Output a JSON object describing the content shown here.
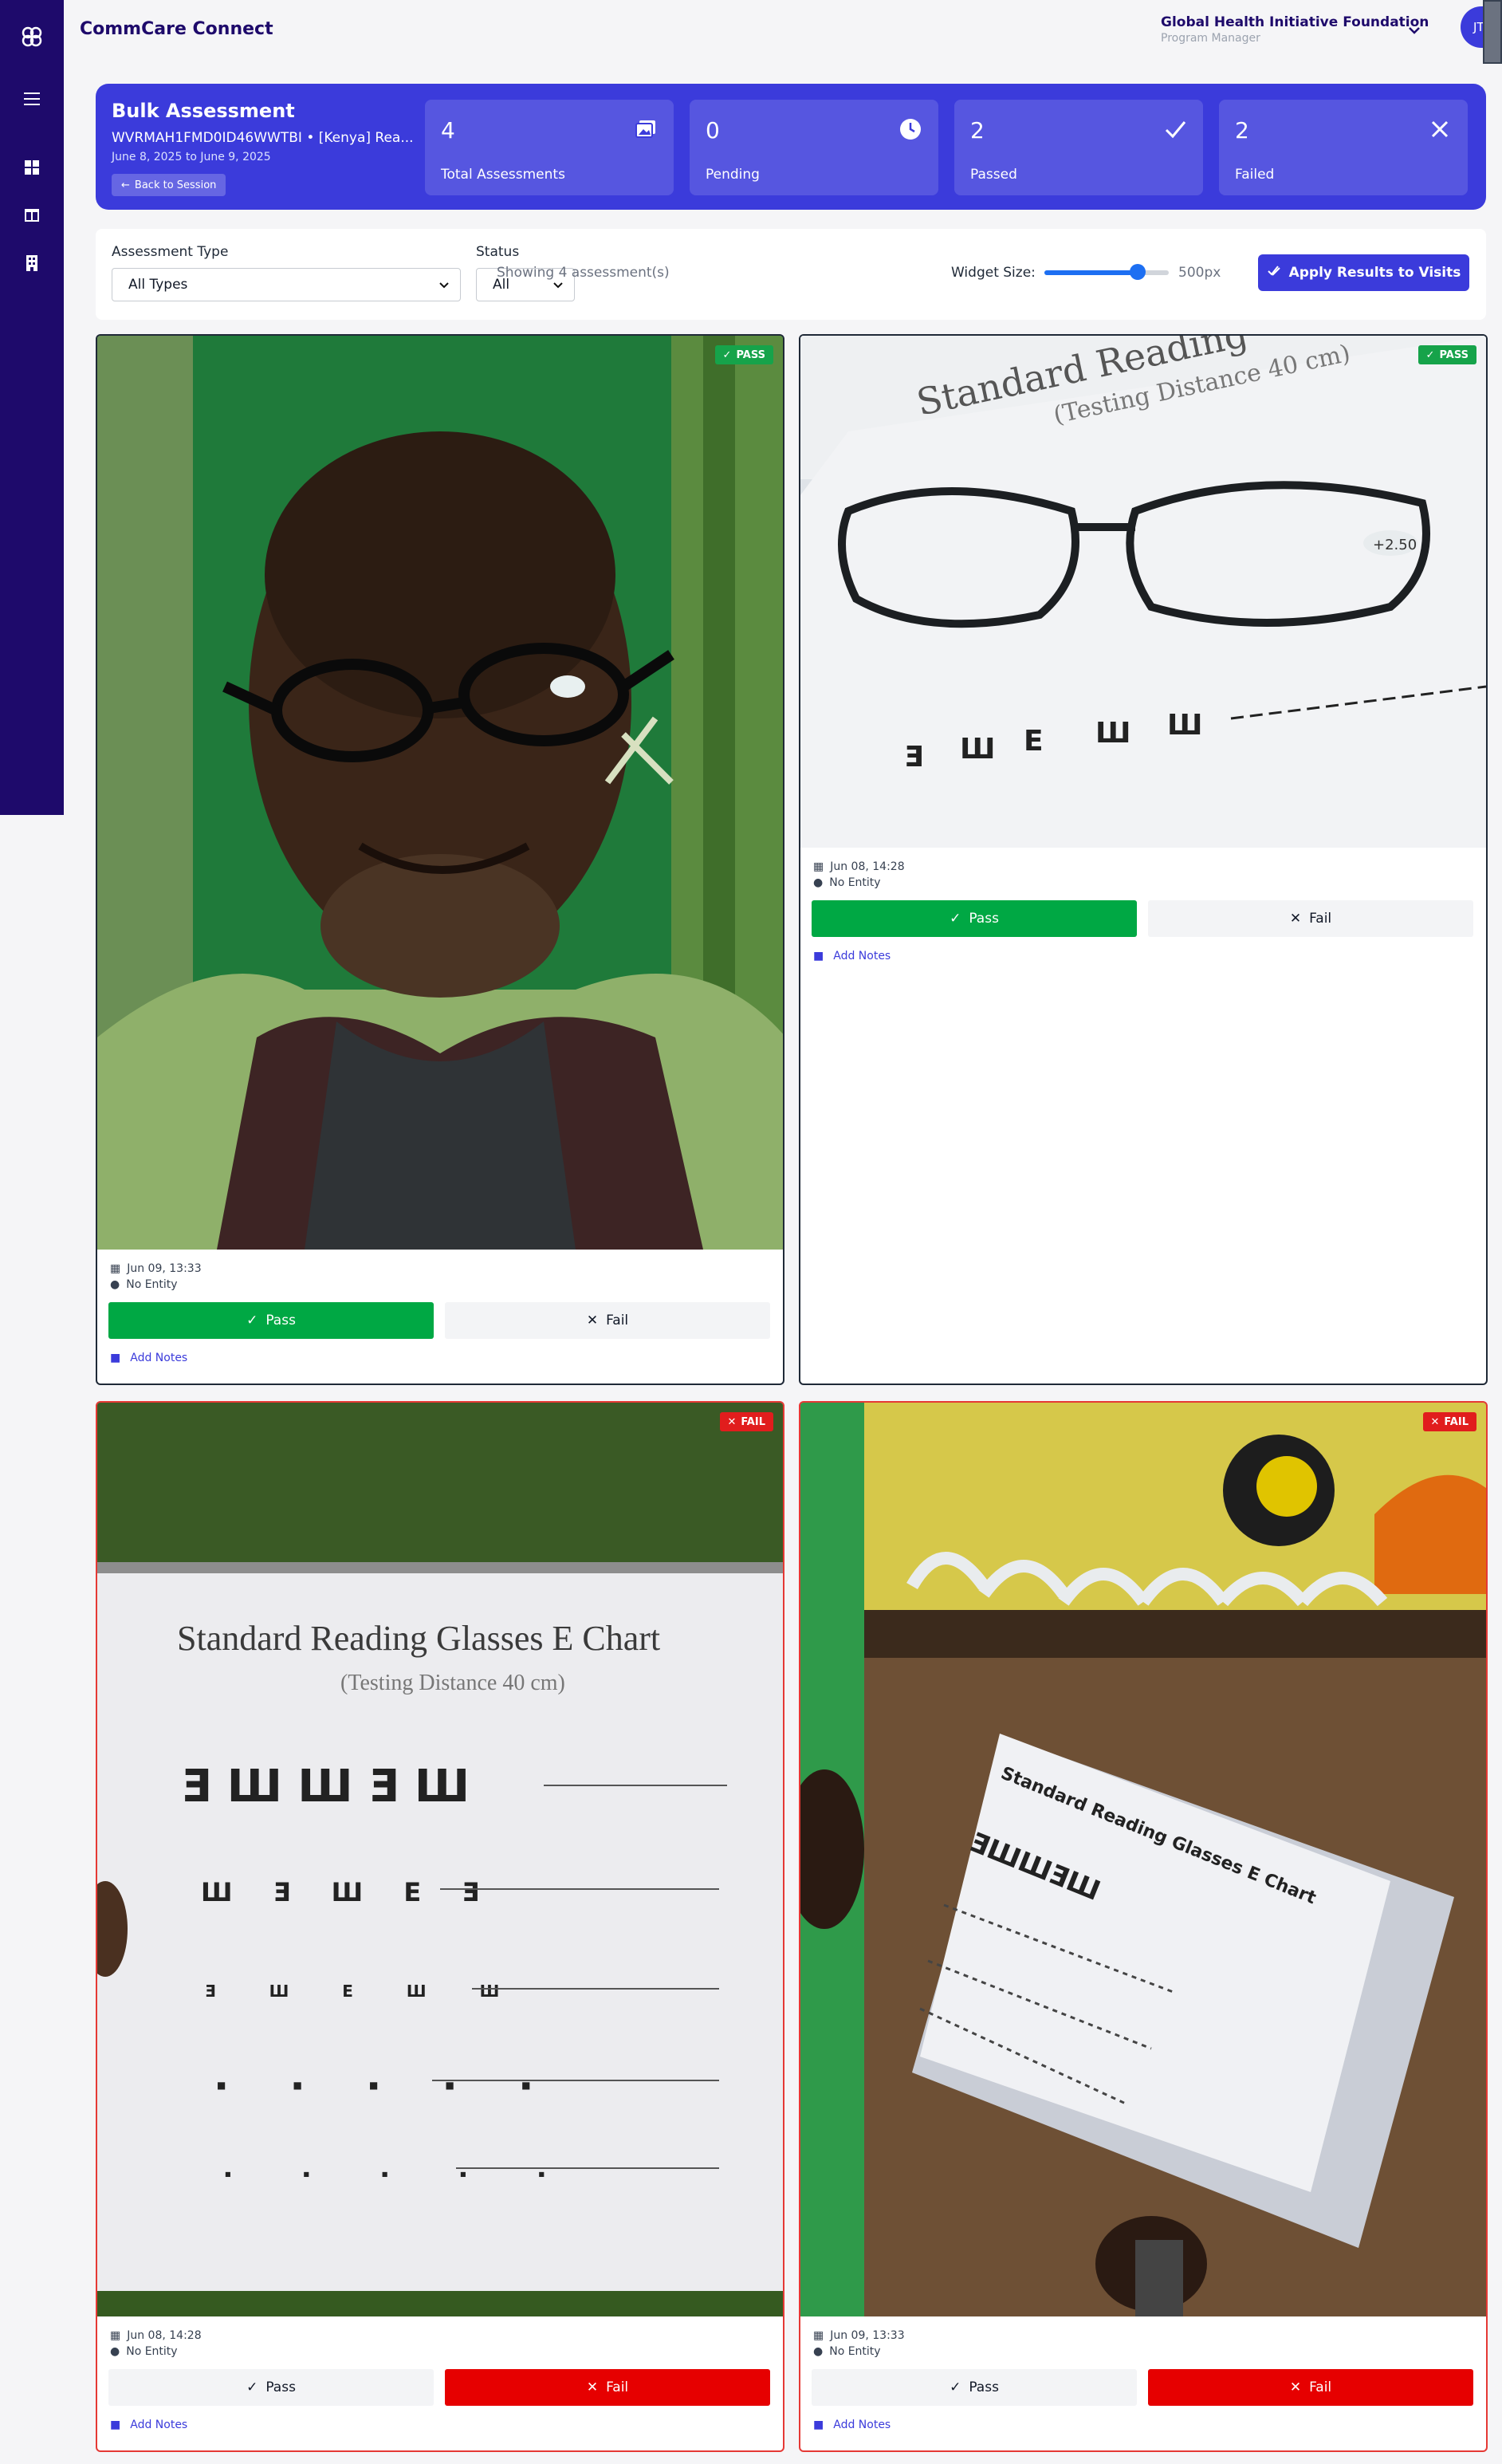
{
  "app": {
    "title": "CommCare Connect"
  },
  "org": {
    "name": "Global Health Initiative Foundation",
    "role": "Program Manager",
    "avatar_initials": "JT"
  },
  "banner": {
    "title": "Bulk Assessment",
    "subtitle": "WVRMAH1FMD0ID46WWTBI • [Kenya] Rea...",
    "dates": "June 8, 2025 to June 9, 2025",
    "back_label": "Back to Session",
    "stats": [
      {
        "value": "4",
        "label": "Total Assessments",
        "icon": "images-icon"
      },
      {
        "value": "0",
        "label": "Pending",
        "icon": "clock-icon"
      },
      {
        "value": "2",
        "label": "Passed",
        "icon": "check-icon"
      },
      {
        "value": "2",
        "label": "Failed",
        "icon": "x-icon"
      }
    ]
  },
  "filters": {
    "assessment_type_label": "Assessment Type",
    "assessment_type_value": "All Types",
    "status_label": "Status",
    "status_value": "All",
    "showing": "Showing 4 assessment(s)",
    "widget_size_label": "Widget Size:",
    "widget_size_value": "500px",
    "widget_size_level": 0.75,
    "apply_label": "Apply Results to Visits"
  },
  "cards": [
    {
      "status_badge": "PASS",
      "date": "Jun 09, 13:33",
      "entity": "No Entity",
      "pass_label": "Pass",
      "fail_label": "Fail",
      "notes_label": "Add Notes",
      "photo": "person wearing reading glasses"
    },
    {
      "status_badge": "PASS",
      "date": "Jun 08, 14:28",
      "entity": "No Entity",
      "pass_label": "Pass",
      "fail_label": "Fail",
      "notes_label": "Add Notes",
      "photo": "reading glasses on E chart"
    },
    {
      "status_badge": "FAIL",
      "date": "Jun 08, 14:28",
      "entity": "No Entity",
      "pass_label": "Pass",
      "fail_label": "Fail",
      "notes_label": "Add Notes",
      "photo": "E chart held up",
      "chart_title": "Standard Reading Glasses E Chart",
      "chart_sub": "(Testing Distance 40 cm)"
    },
    {
      "status_badge": "FAIL",
      "date": "Jun 09, 13:33",
      "entity": "No Entity",
      "pass_label": "Pass",
      "fail_label": "Fail",
      "notes_label": "Add Notes",
      "photo": "E chart held at angle"
    }
  ],
  "colors": {
    "sidebar": "#1e0a6b",
    "accent": "#3b3bdb",
    "pass": "#00a844",
    "fail": "#e60000"
  }
}
